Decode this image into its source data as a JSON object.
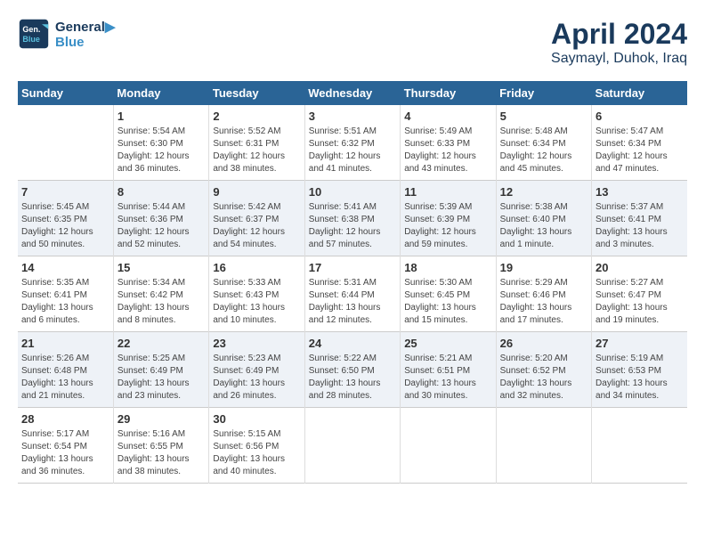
{
  "header": {
    "logo_line1": "General",
    "logo_line2": "Blue",
    "month_title": "April 2024",
    "subtitle": "Saymayl, Duhok, Iraq"
  },
  "weekdays": [
    "Sunday",
    "Monday",
    "Tuesday",
    "Wednesday",
    "Thursday",
    "Friday",
    "Saturday"
  ],
  "weeks": [
    [
      {
        "num": "",
        "info": ""
      },
      {
        "num": "1",
        "info": "Sunrise: 5:54 AM\nSunset: 6:30 PM\nDaylight: 12 hours\nand 36 minutes."
      },
      {
        "num": "2",
        "info": "Sunrise: 5:52 AM\nSunset: 6:31 PM\nDaylight: 12 hours\nand 38 minutes."
      },
      {
        "num": "3",
        "info": "Sunrise: 5:51 AM\nSunset: 6:32 PM\nDaylight: 12 hours\nand 41 minutes."
      },
      {
        "num": "4",
        "info": "Sunrise: 5:49 AM\nSunset: 6:33 PM\nDaylight: 12 hours\nand 43 minutes."
      },
      {
        "num": "5",
        "info": "Sunrise: 5:48 AM\nSunset: 6:34 PM\nDaylight: 12 hours\nand 45 minutes."
      },
      {
        "num": "6",
        "info": "Sunrise: 5:47 AM\nSunset: 6:34 PM\nDaylight: 12 hours\nand 47 minutes."
      }
    ],
    [
      {
        "num": "7",
        "info": "Sunrise: 5:45 AM\nSunset: 6:35 PM\nDaylight: 12 hours\nand 50 minutes."
      },
      {
        "num": "8",
        "info": "Sunrise: 5:44 AM\nSunset: 6:36 PM\nDaylight: 12 hours\nand 52 minutes."
      },
      {
        "num": "9",
        "info": "Sunrise: 5:42 AM\nSunset: 6:37 PM\nDaylight: 12 hours\nand 54 minutes."
      },
      {
        "num": "10",
        "info": "Sunrise: 5:41 AM\nSunset: 6:38 PM\nDaylight: 12 hours\nand 57 minutes."
      },
      {
        "num": "11",
        "info": "Sunrise: 5:39 AM\nSunset: 6:39 PM\nDaylight: 12 hours\nand 59 minutes."
      },
      {
        "num": "12",
        "info": "Sunrise: 5:38 AM\nSunset: 6:40 PM\nDaylight: 13 hours\nand 1 minute."
      },
      {
        "num": "13",
        "info": "Sunrise: 5:37 AM\nSunset: 6:41 PM\nDaylight: 13 hours\nand 3 minutes."
      }
    ],
    [
      {
        "num": "14",
        "info": "Sunrise: 5:35 AM\nSunset: 6:41 PM\nDaylight: 13 hours\nand 6 minutes."
      },
      {
        "num": "15",
        "info": "Sunrise: 5:34 AM\nSunset: 6:42 PM\nDaylight: 13 hours\nand 8 minutes."
      },
      {
        "num": "16",
        "info": "Sunrise: 5:33 AM\nSunset: 6:43 PM\nDaylight: 13 hours\nand 10 minutes."
      },
      {
        "num": "17",
        "info": "Sunrise: 5:31 AM\nSunset: 6:44 PM\nDaylight: 13 hours\nand 12 minutes."
      },
      {
        "num": "18",
        "info": "Sunrise: 5:30 AM\nSunset: 6:45 PM\nDaylight: 13 hours\nand 15 minutes."
      },
      {
        "num": "19",
        "info": "Sunrise: 5:29 AM\nSunset: 6:46 PM\nDaylight: 13 hours\nand 17 minutes."
      },
      {
        "num": "20",
        "info": "Sunrise: 5:27 AM\nSunset: 6:47 PM\nDaylight: 13 hours\nand 19 minutes."
      }
    ],
    [
      {
        "num": "21",
        "info": "Sunrise: 5:26 AM\nSunset: 6:48 PM\nDaylight: 13 hours\nand 21 minutes."
      },
      {
        "num": "22",
        "info": "Sunrise: 5:25 AM\nSunset: 6:49 PM\nDaylight: 13 hours\nand 23 minutes."
      },
      {
        "num": "23",
        "info": "Sunrise: 5:23 AM\nSunset: 6:49 PM\nDaylight: 13 hours\nand 26 minutes."
      },
      {
        "num": "24",
        "info": "Sunrise: 5:22 AM\nSunset: 6:50 PM\nDaylight: 13 hours\nand 28 minutes."
      },
      {
        "num": "25",
        "info": "Sunrise: 5:21 AM\nSunset: 6:51 PM\nDaylight: 13 hours\nand 30 minutes."
      },
      {
        "num": "26",
        "info": "Sunrise: 5:20 AM\nSunset: 6:52 PM\nDaylight: 13 hours\nand 32 minutes."
      },
      {
        "num": "27",
        "info": "Sunrise: 5:19 AM\nSunset: 6:53 PM\nDaylight: 13 hours\nand 34 minutes."
      }
    ],
    [
      {
        "num": "28",
        "info": "Sunrise: 5:17 AM\nSunset: 6:54 PM\nDaylight: 13 hours\nand 36 minutes."
      },
      {
        "num": "29",
        "info": "Sunrise: 5:16 AM\nSunset: 6:55 PM\nDaylight: 13 hours\nand 38 minutes."
      },
      {
        "num": "30",
        "info": "Sunrise: 5:15 AM\nSunset: 6:56 PM\nDaylight: 13 hours\nand 40 minutes."
      },
      {
        "num": "",
        "info": ""
      },
      {
        "num": "",
        "info": ""
      },
      {
        "num": "",
        "info": ""
      },
      {
        "num": "",
        "info": ""
      }
    ]
  ]
}
